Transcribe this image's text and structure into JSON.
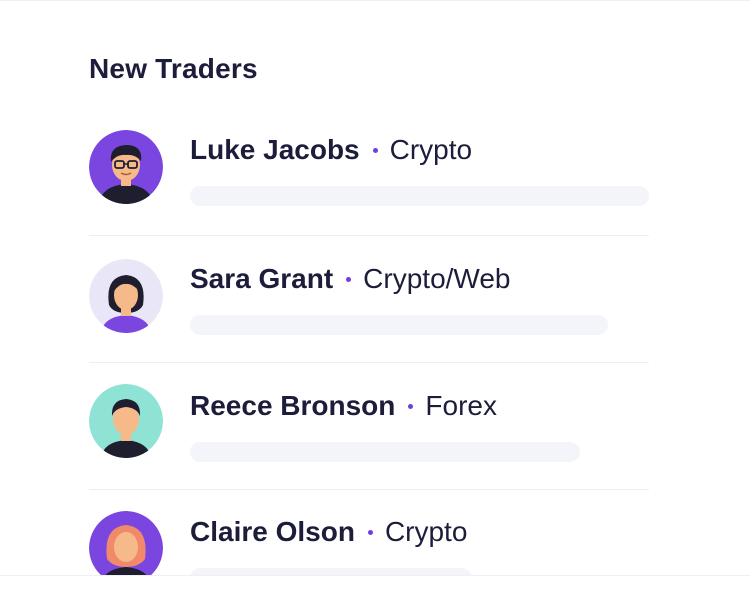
{
  "section": {
    "title": "New Traders"
  },
  "traders": [
    {
      "name": "Luke Jacobs",
      "category": "Crypto",
      "avatar_icon": "avatar-glasses-man-icon",
      "avatar_bg": "#7b45e0"
    },
    {
      "name": "Sara Grant",
      "category": "Crypto/Web",
      "avatar_icon": "avatar-woman-icon",
      "avatar_bg": "#e8e6f7"
    },
    {
      "name": "Reece Bronson",
      "category": "Forex",
      "avatar_icon": "avatar-man-icon",
      "avatar_bg": "#8fe3d4"
    },
    {
      "name": "Claire Olson",
      "category": "Crypto",
      "avatar_icon": "avatar-redhead-woman-icon",
      "avatar_bg": "#7b45e0"
    }
  ],
  "colors": {
    "text": "#1b1d3a",
    "accent": "#6c3fe0",
    "placeholder_bar": "#f3f5fa",
    "divider": "#eceef4"
  }
}
